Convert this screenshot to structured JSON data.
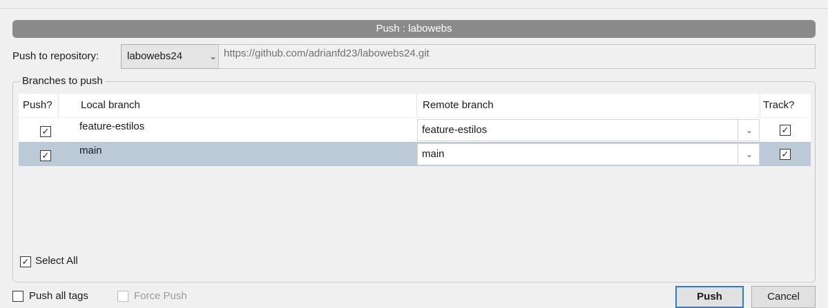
{
  "dialog": {
    "title": "Push : labowebs"
  },
  "repository": {
    "label": "Push to repository:",
    "selected": "labowebs24",
    "url": "https://github.com/adrianfd23/labowebs24.git"
  },
  "branches": {
    "group_label": "Branches to push",
    "columns": {
      "push": "Push?",
      "local": "Local branch",
      "remote": "Remote branch",
      "track": "Track?"
    },
    "rows": [
      {
        "push": true,
        "local": "feature-estilos",
        "remote": "feature-estilos",
        "track": true,
        "selected": false
      },
      {
        "push": true,
        "local": "main",
        "remote": "main",
        "track": true,
        "selected": true
      }
    ]
  },
  "select_all": {
    "label": "Select All",
    "checked": true
  },
  "options": {
    "push_all_tags": {
      "label": "Push all tags",
      "checked": false
    },
    "force_push": {
      "label": "Force Push",
      "checked": false,
      "disabled": true
    }
  },
  "buttons": {
    "push": "Push",
    "cancel": "Cancel"
  },
  "icons": {
    "check": "✓",
    "chevron_down": "⌄"
  },
  "colors": {
    "title_bar": "#8a8a8a",
    "selected_row": "#bccad8",
    "default_button_border": "#2b7bd4"
  }
}
